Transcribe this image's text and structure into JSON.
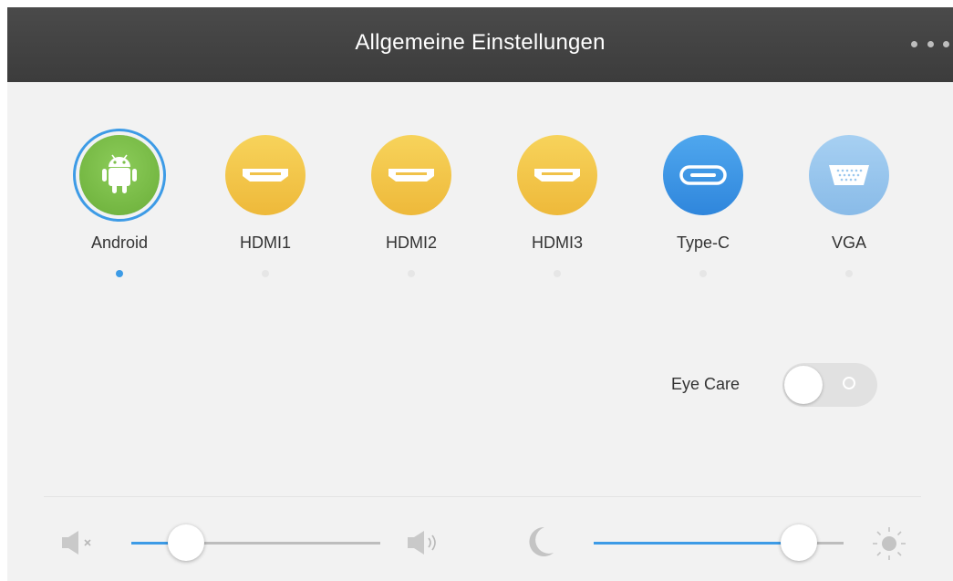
{
  "window": {
    "title": "Allgemeine Einstellungen",
    "menu_icon": "more-dots-icon"
  },
  "sources": [
    {
      "label": "Android",
      "icon": "android-icon",
      "color": "#7cbf4a",
      "selected": true
    },
    {
      "label": "HDMI1",
      "icon": "hdmi-port-icon",
      "color": "#f2c94c",
      "selected": false
    },
    {
      "label": "HDMI2",
      "icon": "hdmi-port-icon",
      "color": "#f2c94c",
      "selected": false
    },
    {
      "label": "HDMI3",
      "icon": "hdmi-port-icon",
      "color": "#f2c94c",
      "selected": false
    },
    {
      "label": "Type-C",
      "icon": "usb-type-c-icon",
      "color": "#3d9be6",
      "selected": false
    },
    {
      "label": "VGA",
      "icon": "vga-port-icon",
      "color": "#9cc8ee",
      "selected": false
    }
  ],
  "eye_care": {
    "label": "Eye Care",
    "enabled": false
  },
  "volume": {
    "min_icon": "speaker-mute-icon",
    "max_icon": "speaker-loud-icon",
    "level": 0.22
  },
  "brightness": {
    "min_icon": "moon-icon",
    "max_icon": "sun-icon",
    "level": 0.82
  },
  "colors": {
    "accent": "#3d9be6",
    "titlebar": "#3f3f3f",
    "background": "#f2f2f2"
  }
}
